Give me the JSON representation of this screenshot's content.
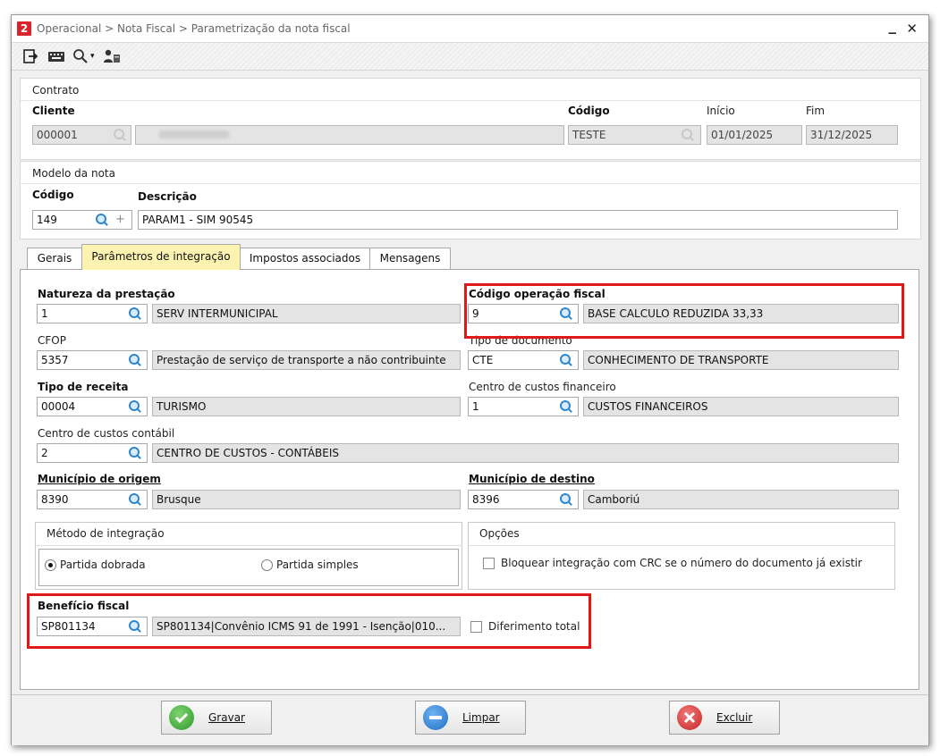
{
  "window": {
    "app_icon_glyph": "2",
    "title": "Operacional > Nota Fiscal > Parametrização da nota fiscal",
    "minimize_glyph": "_",
    "close_glyph": "✕"
  },
  "toolbar": {
    "icons": [
      "exit-icon",
      "keyboard-icon",
      "search-dropdown-icon",
      "users-icon"
    ],
    "search_arrow": "▾"
  },
  "contrato": {
    "caption": "Contrato",
    "cliente_label": "Cliente",
    "cliente_code": "000001",
    "codigo_label": "Código",
    "codigo_value": "TESTE",
    "inicio_label": "Início",
    "inicio_value": "01/01/2025",
    "fim_label": "Fim",
    "fim_value": "31/12/2025"
  },
  "modelo": {
    "caption": "Modelo da nota",
    "codigo_label": "Código",
    "codigo_value": "149",
    "descricao_label": "Descrição",
    "descricao_value": "PARAM1 - SIM 90545",
    "plus_glyph": "+"
  },
  "tabs": [
    "Gerais",
    "Parâmetros de integração",
    "Impostos associados",
    "Mensagens"
  ],
  "form": {
    "natureza": {
      "label": "Natureza da prestação",
      "code": "1",
      "desc": "SERV INTERMUNICIPAL"
    },
    "codigo_operacao": {
      "label": "Código operação fiscal",
      "code": "9",
      "desc": "BASE CALCULO REDUZIDA 33,33"
    },
    "cfop": {
      "label": "CFOP",
      "code": "5357",
      "desc": "Prestação de serviço de transporte a não contribuinte"
    },
    "tipo_documento": {
      "label": "Tipo de documento",
      "code": "CTE",
      "desc": "CONHECIMENTO DE TRANSPORTE"
    },
    "tipo_receita": {
      "label": "Tipo de receita",
      "code": "00004",
      "desc": "TURISMO"
    },
    "cc_financeiro": {
      "label": "Centro de custos financeiro",
      "code": "1",
      "desc": "CUSTOS FINANCEIROS"
    },
    "cc_contabil": {
      "label": "Centro de custos contábil",
      "code": "2",
      "desc": "CENTRO DE CUSTOS - CONTÁBEIS"
    },
    "municipio_origem": {
      "label": "Município de origem",
      "code": "8390",
      "desc": "Brusque"
    },
    "municipio_destino": {
      "label": "Município de destino",
      "code": "8396",
      "desc": "Camboriú"
    },
    "metodo": {
      "title": "Método de integração",
      "option1": "Partida dobrada",
      "option2": "Partida simples",
      "selected": "Partida dobrada"
    },
    "opcoes": {
      "title": "Opções",
      "checkbox_label": "Bloquear integração com CRC se o número do documento já existir",
      "checked": false
    },
    "beneficio": {
      "label": "Benefício fiscal",
      "code": "SP801134",
      "desc": "SP801134|Convênio ICMS 91 de 1991 - Isenção|010...",
      "diferimento_label": "Diferimento total",
      "diferimento_checked": false
    }
  },
  "buttons": {
    "gravar": "Gravar",
    "limpar": "Limpar",
    "excluir": "Excluir"
  },
  "colors": {
    "highlight": "#e01818",
    "active_tab": "#fdf3b0",
    "gravar": "#3aa83a",
    "limpar": "#2f7fd1",
    "excluir": "#d93030"
  }
}
